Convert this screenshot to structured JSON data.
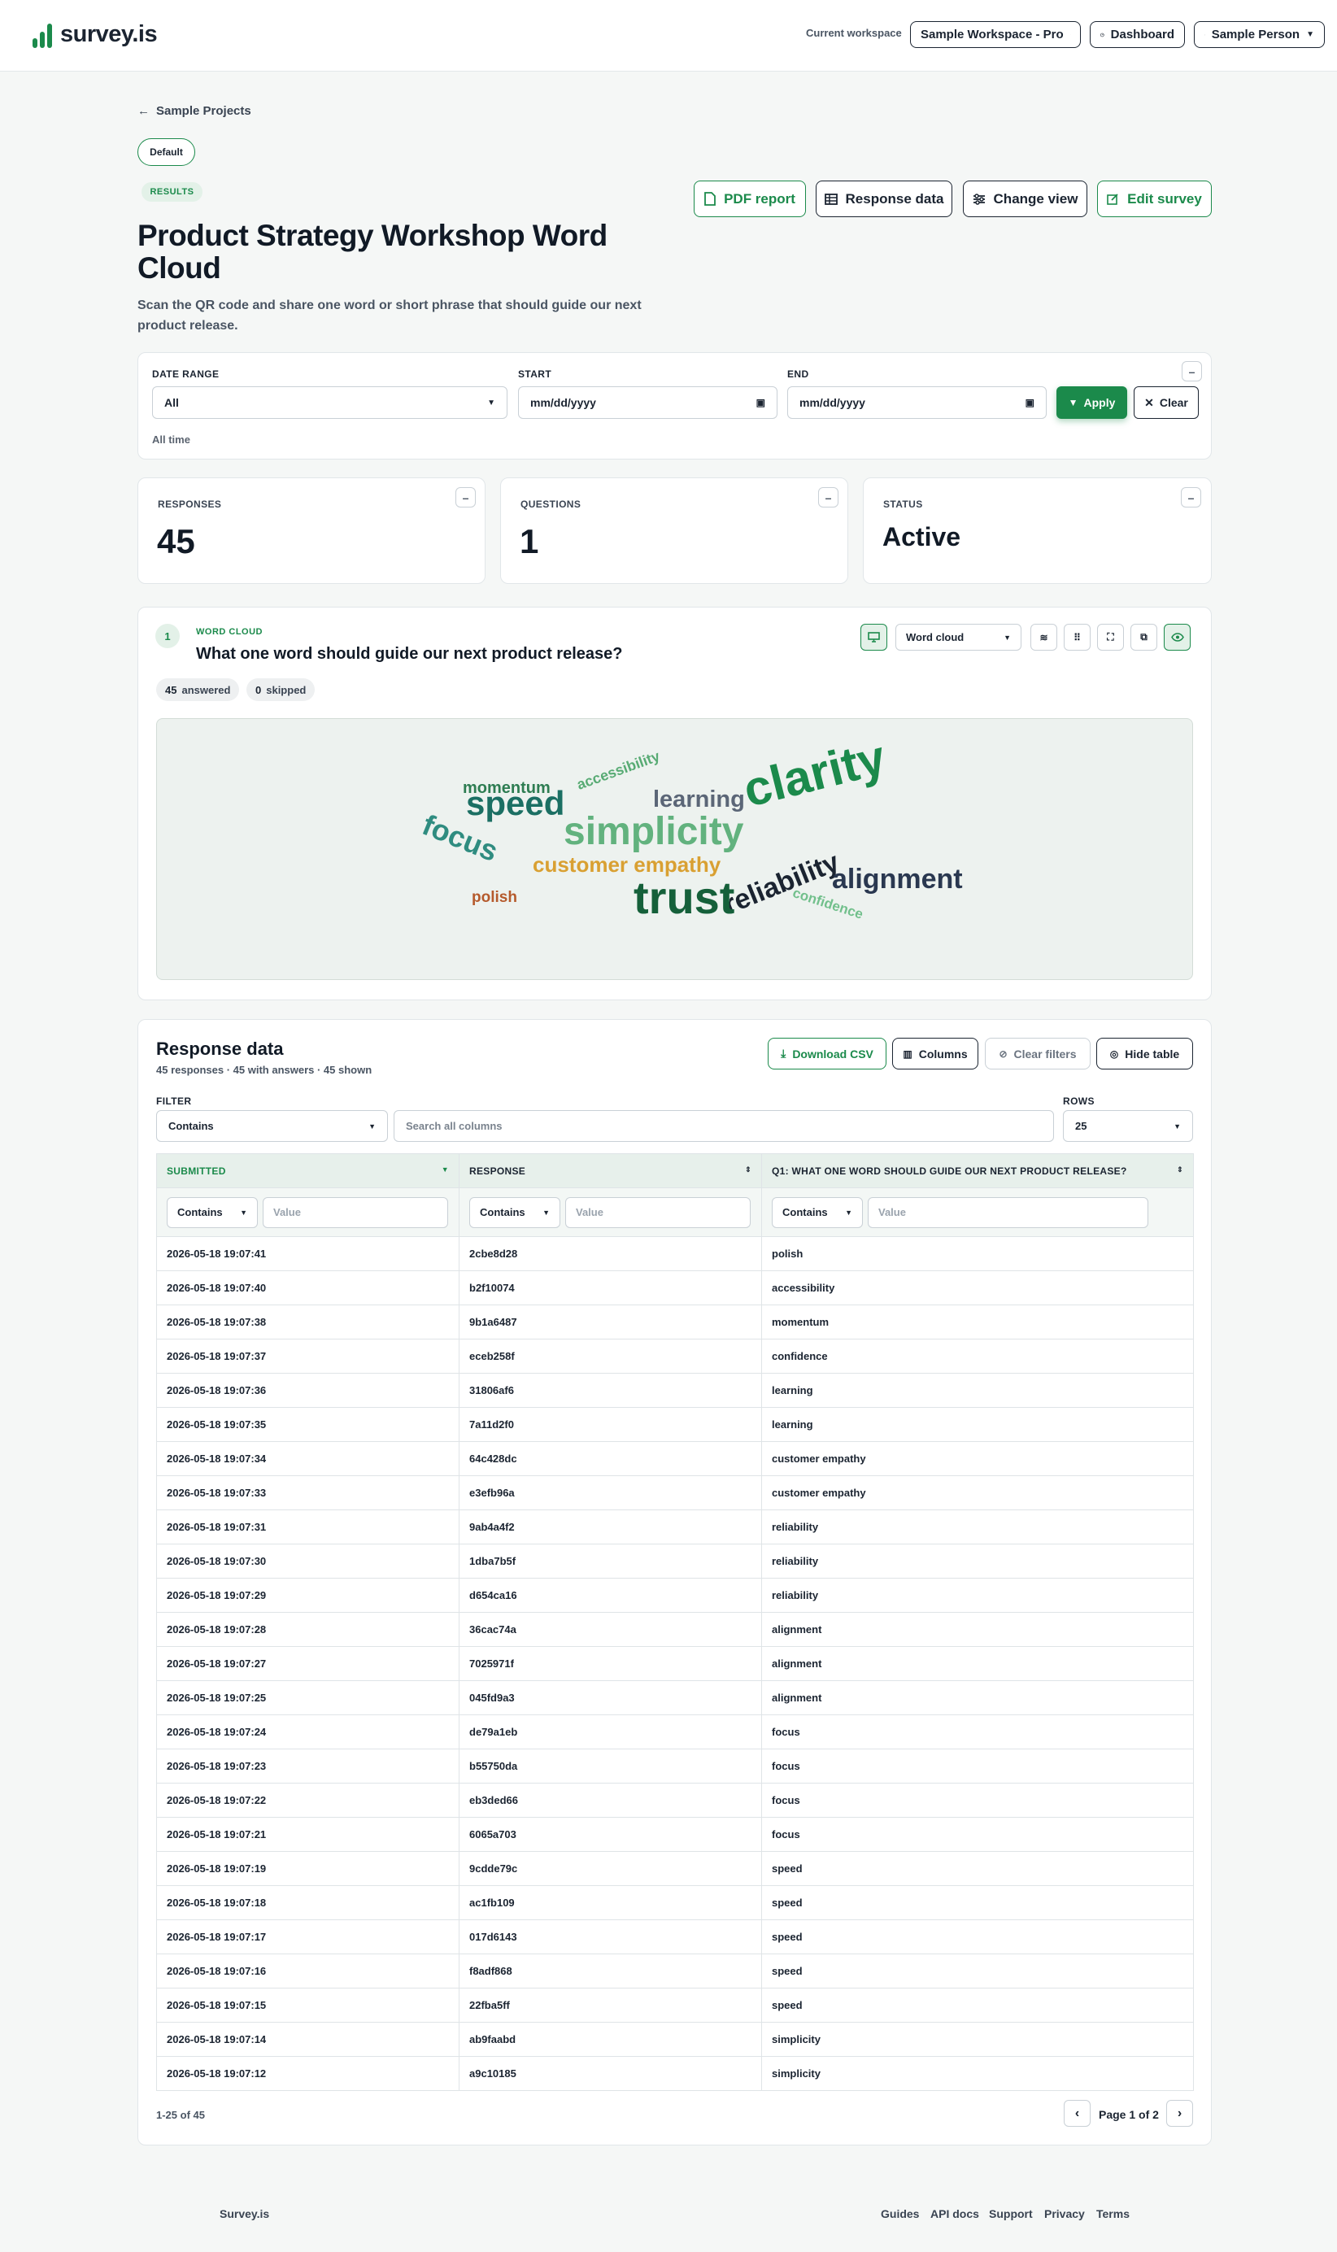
{
  "header": {
    "logo_text": "survey.is",
    "workspace_label": "Current workspace",
    "workspace_value": "Sample Workspace - Pro",
    "dashboard_label": "Dashboard",
    "user_label": "Sample Person"
  },
  "page": {
    "back_label": "Sample Projects",
    "default_badge": "Default",
    "results_badge": "RESULTS",
    "title": "Product Strategy Workshop Word Cloud",
    "subtitle": "Scan the QR code and share one word or short phrase that should guide our next product release.",
    "actions": {
      "pdf": "PDF report",
      "response_data": "Response data",
      "change_view": "Change view",
      "edit": "Edit survey"
    }
  },
  "date_filter": {
    "range_label": "DATE RANGE",
    "range_value": "All",
    "start_label": "START",
    "start_placeholder": "mm/dd/yyyy",
    "end_label": "END",
    "end_placeholder": "mm/dd/yyyy",
    "apply_label": "Apply",
    "clear_label": "Clear",
    "summary": "All time"
  },
  "stats": [
    {
      "label": "RESPONSES",
      "value": "45"
    },
    {
      "label": "QUESTIONS",
      "value": "1"
    },
    {
      "label": "STATUS",
      "value": "Active"
    }
  ],
  "question": {
    "number": "1",
    "type_label": "WORD CLOUD",
    "text": "What one word should guide our next product release?",
    "answered_count": "45",
    "answered_label": "answered",
    "skipped_count": "0",
    "skipped_label": "skipped",
    "view_select": "Word cloud"
  },
  "word_cloud": [
    {
      "word": "momentum",
      "color": "#2e7d52"
    },
    {
      "word": "speed",
      "color": "#1b6f63"
    },
    {
      "word": "accessibility",
      "color": "#58ab74"
    },
    {
      "word": "learning",
      "color": "#5b6677"
    },
    {
      "word": "clarity",
      "color": "#1b8a4b"
    },
    {
      "word": "focus",
      "color": "#2f8c80"
    },
    {
      "word": "simplicity",
      "color": "#62b27e"
    },
    {
      "word": "customer empathy",
      "color": "#d9a032"
    },
    {
      "word": "reliability",
      "color": "#1b2431"
    },
    {
      "word": "alignment",
      "color": "#2a3850"
    },
    {
      "word": "polish",
      "color": "#b55a2c"
    },
    {
      "word": "trust",
      "color": "#15603a"
    },
    {
      "word": "confidence",
      "color": "#72c08c"
    }
  ],
  "response_table": {
    "title": "Response data",
    "summary": "45 responses · 45 with answers · 45 shown",
    "download_label": "Download CSV",
    "columns_label": "Columns",
    "clear_filters_label": "Clear filters",
    "hide_label": "Hide table",
    "filter_label": "FILTER",
    "filter_mode": "Contains",
    "search_placeholder": "Search all columns",
    "rows_label": "ROWS",
    "rows_value": "25",
    "headers": [
      "SUBMITTED",
      "RESPONSE",
      "Q1: WHAT ONE WORD SHOULD GUIDE OUR NEXT PRODUCT RELEASE?"
    ],
    "col_filter_mode": "Contains",
    "col_filter_placeholder": "Value",
    "rows": [
      [
        "2026-05-18 19:07:41",
        "2cbe8d28",
        "polish"
      ],
      [
        "2026-05-18 19:07:40",
        "b2f10074",
        "accessibility"
      ],
      [
        "2026-05-18 19:07:38",
        "9b1a6487",
        "momentum"
      ],
      [
        "2026-05-18 19:07:37",
        "eceb258f",
        "confidence"
      ],
      [
        "2026-05-18 19:07:36",
        "31806af6",
        "learning"
      ],
      [
        "2026-05-18 19:07:35",
        "7a11d2f0",
        "learning"
      ],
      [
        "2026-05-18 19:07:34",
        "64c428dc",
        "customer empathy"
      ],
      [
        "2026-05-18 19:07:33",
        "e3efb96a",
        "customer empathy"
      ],
      [
        "2026-05-18 19:07:31",
        "9ab4a4f2",
        "reliability"
      ],
      [
        "2026-05-18 19:07:30",
        "1dba7b5f",
        "reliability"
      ],
      [
        "2026-05-18 19:07:29",
        "d654ca16",
        "reliability"
      ],
      [
        "2026-05-18 19:07:28",
        "36cac74a",
        "alignment"
      ],
      [
        "2026-05-18 19:07:27",
        "7025971f",
        "alignment"
      ],
      [
        "2026-05-18 19:07:25",
        "045fd9a3",
        "alignment"
      ],
      [
        "2026-05-18 19:07:24",
        "de79a1eb",
        "focus"
      ],
      [
        "2026-05-18 19:07:23",
        "b55750da",
        "focus"
      ],
      [
        "2026-05-18 19:07:22",
        "eb3ded66",
        "focus"
      ],
      [
        "2026-05-18 19:07:21",
        "6065a703",
        "focus"
      ],
      [
        "2026-05-18 19:07:19",
        "9cdde79c",
        "speed"
      ],
      [
        "2026-05-18 19:07:18",
        "ac1fb109",
        "speed"
      ],
      [
        "2026-05-18 19:07:17",
        "017d6143",
        "speed"
      ],
      [
        "2026-05-18 19:07:16",
        "f8adf868",
        "speed"
      ],
      [
        "2026-05-18 19:07:15",
        "22fba5ff",
        "speed"
      ],
      [
        "2026-05-18 19:07:14",
        "ab9faabd",
        "simplicity"
      ],
      [
        "2026-05-18 19:07:12",
        "a9c10185",
        "simplicity"
      ]
    ],
    "range_text": "1-25 of 45",
    "page_text": "Page 1 of 2"
  },
  "footer": {
    "brand": "Survey.is",
    "links": [
      "Guides",
      "API docs",
      "Support",
      "Privacy",
      "Terms"
    ]
  }
}
